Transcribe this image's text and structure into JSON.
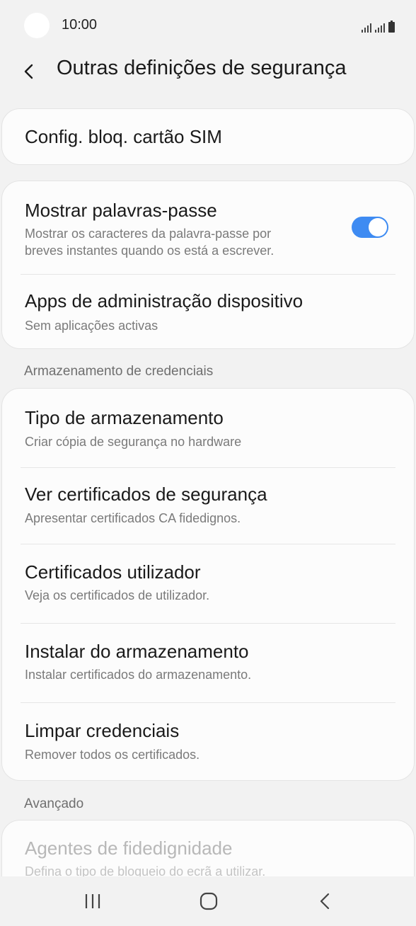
{
  "status_bar": {
    "time": "10:00"
  },
  "header": {
    "title": "Outras definições de segurança"
  },
  "sim_card": {
    "title": "Config. bloq. cartão SIM"
  },
  "password_settings": {
    "show_passwords": {
      "title": "Mostrar palavras-passe",
      "subtitle_line1": "Mostrar os caracteres da palavra-passe por",
      "subtitle_line2": "breves instantes quando os está a escrever.",
      "enabled": true
    },
    "device_admin": {
      "title": "Apps de administração dispositivo",
      "subtitle": "Sem aplicações activas"
    }
  },
  "credential_storage": {
    "section_label": "Armazenamento de credenciais",
    "items": [
      {
        "title": "Tipo de armazenamento",
        "subtitle": "Criar cópia de segurança no hardware"
      },
      {
        "title": "Ver certificados de segurança",
        "subtitle": "Apresentar certificados CA fidedignos."
      },
      {
        "title": "Certificados utilizador",
        "subtitle": "Veja os certificados de utilizador."
      },
      {
        "title": "Instalar do armazenamento",
        "subtitle": "Instalar certificados do armazenamento."
      },
      {
        "title": "Limpar credenciais",
        "subtitle": "Remover todos os certificados."
      }
    ]
  },
  "advanced": {
    "section_label": "Avançado",
    "trust_agents": {
      "title": "Agentes de fidedignidade",
      "subtitle": "Defina o tipo de bloqueio do ecrã a utilizar."
    }
  },
  "icons": {
    "back": "chevron-left-icon",
    "recents": "recents-icon",
    "home": "home-icon",
    "nav_back": "back-icon"
  },
  "colors": {
    "accent": "#3e8bf2",
    "background": "#f2f2f2",
    "card": "#fcfcfc"
  }
}
